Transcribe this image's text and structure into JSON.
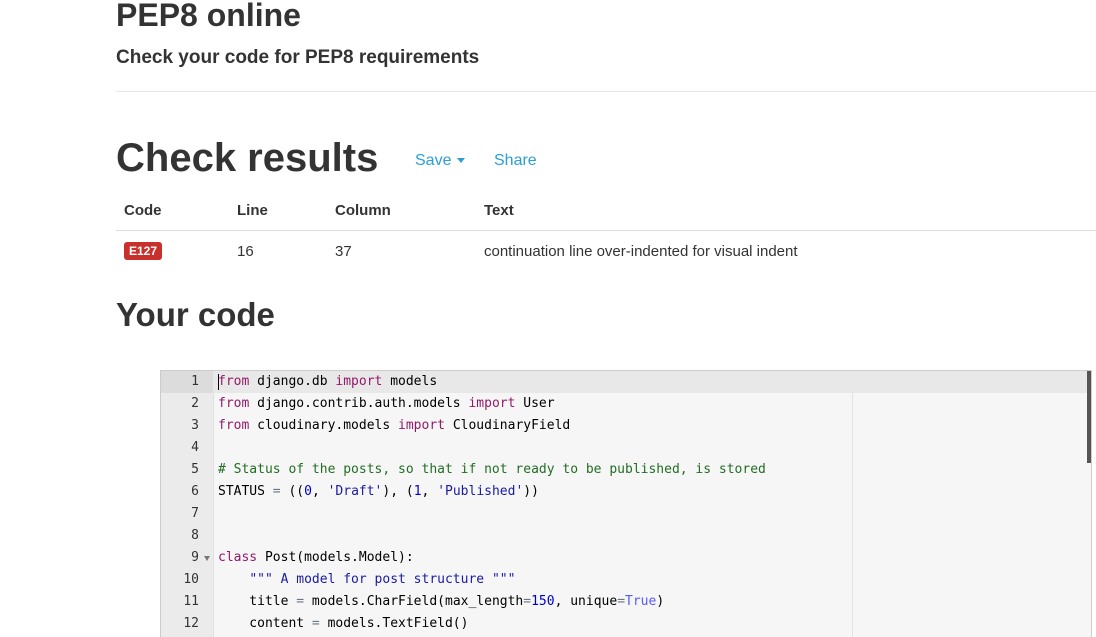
{
  "header": {
    "title": "PEP8 online",
    "subtitle": "Check your code for PEP8 requirements"
  },
  "results": {
    "title": "Check results",
    "save_label": "Save",
    "share_label": "Share",
    "columns": [
      "Code",
      "Line",
      "Column",
      "Text"
    ],
    "rows": [
      {
        "code": "E127",
        "line": "16",
        "column": "37",
        "text": "continuation line over-indented for visual indent",
        "badge_color": "#c9302c"
      }
    ]
  },
  "code_section": {
    "title": "Your code"
  },
  "editor": {
    "lines": [
      {
        "num": "1",
        "tokens": [
          [
            "kw",
            "from"
          ],
          [
            "",
            " django.db "
          ],
          [
            "kw",
            "import"
          ],
          [
            "",
            " models"
          ]
        ]
      },
      {
        "num": "2",
        "tokens": [
          [
            "kw",
            "from"
          ],
          [
            "",
            " django.contrib.auth.models "
          ],
          [
            "kw",
            "import"
          ],
          [
            "",
            " User"
          ]
        ]
      },
      {
        "num": "3",
        "tokens": [
          [
            "kw",
            "from"
          ],
          [
            "",
            " cloudinary.models "
          ],
          [
            "kw",
            "import"
          ],
          [
            "",
            " CloudinaryField"
          ]
        ]
      },
      {
        "num": "4",
        "tokens": []
      },
      {
        "num": "5",
        "tokens": [
          [
            "cmt",
            "# Status of the posts, so that if not ready to be published, is stored"
          ]
        ]
      },
      {
        "num": "6",
        "tokens": [
          [
            "",
            "STATUS "
          ],
          [
            "op",
            "="
          ],
          [
            "",
            " (("
          ],
          [
            "num",
            "0"
          ],
          [
            "",
            ", "
          ],
          [
            "str",
            "'Draft'"
          ],
          [
            "",
            "), ("
          ],
          [
            "num",
            "1"
          ],
          [
            "",
            ", "
          ],
          [
            "str",
            "'Published'"
          ],
          [
            "",
            "))"
          ]
        ]
      },
      {
        "num": "7",
        "tokens": []
      },
      {
        "num": "8",
        "tokens": []
      },
      {
        "num": "9",
        "fold": true,
        "tokens": [
          [
            "kw",
            "class"
          ],
          [
            "",
            " Post(models.Model):"
          ]
        ]
      },
      {
        "num": "10",
        "tokens": [
          [
            "",
            "    "
          ],
          [
            "str",
            "\"\"\" A model for post structure \"\"\""
          ]
        ]
      },
      {
        "num": "11",
        "tokens": [
          [
            "",
            "    title "
          ],
          [
            "op",
            "="
          ],
          [
            "",
            " models.CharField(max_length"
          ],
          [
            "op",
            "="
          ],
          [
            "num",
            "150"
          ],
          [
            "",
            ", unique"
          ],
          [
            "op",
            "="
          ],
          [
            "bool",
            "True"
          ],
          [
            "",
            ")"
          ]
        ]
      },
      {
        "num": "12",
        "tokens": [
          [
            "",
            "    content "
          ],
          [
            "op",
            "="
          ],
          [
            "",
            " models.TextField()"
          ]
        ]
      }
    ]
  },
  "colors": {
    "link": "#2a9fd6",
    "error_badge": "#c9302c",
    "keyword": "#931a68",
    "string": "#1a1aa6",
    "number": "#0000cd",
    "comment": "#236e24"
  }
}
